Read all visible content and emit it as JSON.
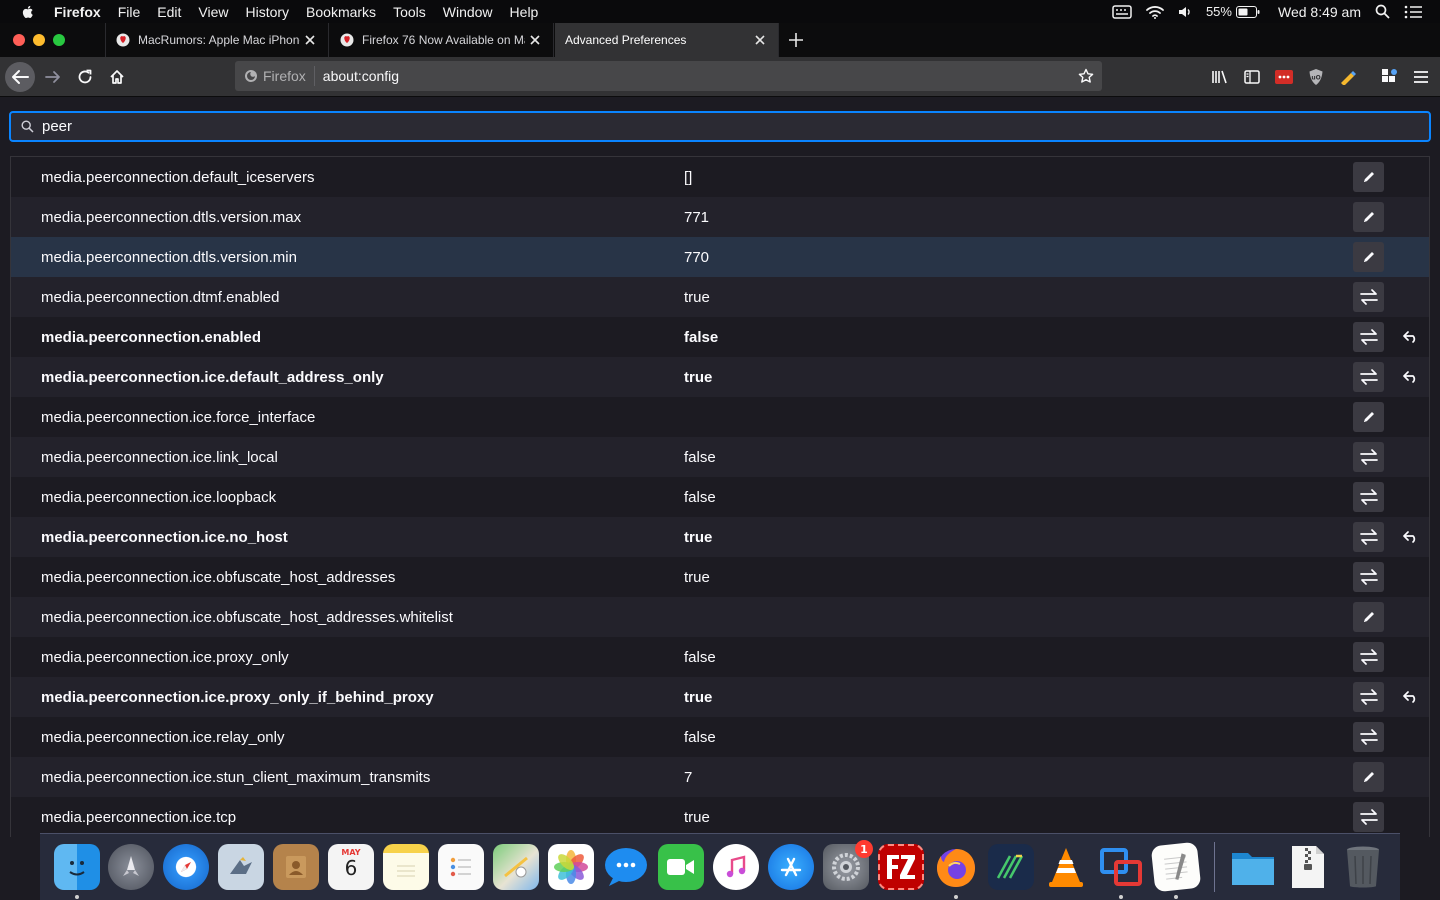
{
  "menubar": {
    "app": "Firefox",
    "items": [
      "File",
      "Edit",
      "View",
      "History",
      "Bookmarks",
      "Tools",
      "Window",
      "Help"
    ],
    "battery": "55%",
    "clock": "Wed 8:49 am"
  },
  "tabs": [
    {
      "title": "MacRumors: Apple Mac iPhone"
    },
    {
      "title": "Firefox 76 Now Available on Ma"
    },
    {
      "title": "Advanced Preferences"
    }
  ],
  "urlbar": {
    "identity": "Firefox",
    "url": "about:config"
  },
  "search": {
    "value": "peer"
  },
  "prefs": [
    {
      "name": "media.peerconnection.default_iceservers",
      "value": "[]",
      "action": "edit",
      "modified": false
    },
    {
      "name": "media.peerconnection.dtls.version.max",
      "value": "771",
      "action": "edit",
      "modified": false
    },
    {
      "name": "media.peerconnection.dtls.version.min",
      "value": "770",
      "action": "edit",
      "modified": false
    },
    {
      "name": "media.peerconnection.dtmf.enabled",
      "value": "true",
      "action": "toggle",
      "modified": false
    },
    {
      "name": "media.peerconnection.enabled",
      "value": "false",
      "action": "toggle",
      "modified": true
    },
    {
      "name": "media.peerconnection.ice.default_address_only",
      "value": "true",
      "action": "toggle",
      "modified": true
    },
    {
      "name": "media.peerconnection.ice.force_interface",
      "value": "",
      "action": "edit",
      "modified": false
    },
    {
      "name": "media.peerconnection.ice.link_local",
      "value": "false",
      "action": "toggle",
      "modified": false
    },
    {
      "name": "media.peerconnection.ice.loopback",
      "value": "false",
      "action": "toggle",
      "modified": false
    },
    {
      "name": "media.peerconnection.ice.no_host",
      "value": "true",
      "action": "toggle",
      "modified": true
    },
    {
      "name": "media.peerconnection.ice.obfuscate_host_addresses",
      "value": "true",
      "action": "toggle",
      "modified": false
    },
    {
      "name": "media.peerconnection.ice.obfuscate_host_addresses.whitelist",
      "value": "",
      "action": "edit",
      "modified": false
    },
    {
      "name": "media.peerconnection.ice.proxy_only",
      "value": "false",
      "action": "toggle",
      "modified": false
    },
    {
      "name": "media.peerconnection.ice.proxy_only_if_behind_proxy",
      "value": "true",
      "action": "toggle",
      "modified": true
    },
    {
      "name": "media.peerconnection.ice.relay_only",
      "value": "false",
      "action": "toggle",
      "modified": false
    },
    {
      "name": "media.peerconnection.ice.stun_client_maximum_transmits",
      "value": "7",
      "action": "edit",
      "modified": false
    },
    {
      "name": "media.peerconnection.ice.tcp",
      "value": "true",
      "action": "toggle",
      "modified": false
    }
  ],
  "dock": {
    "calendar_month": "MAY",
    "calendar_day": "6",
    "system_prefs_badge": "1"
  },
  "colors": {
    "accent": "#0a84ff",
    "highlight_row": "#283447",
    "background": "#1c1b22"
  }
}
